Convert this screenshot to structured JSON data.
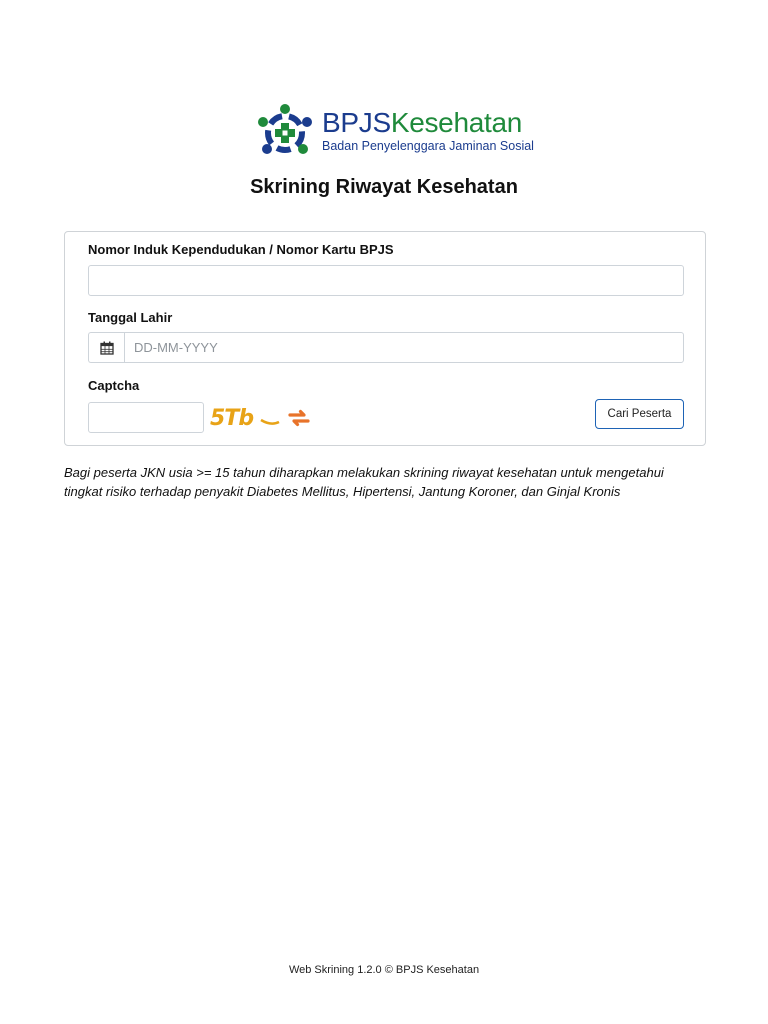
{
  "header": {
    "logo_brand_part1": "BPJS",
    "logo_brand_part2": "Kesehatan",
    "logo_subtitle": "Badan Penyelenggara Jaminan Sosial",
    "page_title": "Skrining Riwayat Kesehatan"
  },
  "form": {
    "nik_label": "Nomor Induk Kependudukan / Nomor Kartu BPJS",
    "nik_value": "",
    "dob_label": "Tanggal Lahir",
    "dob_placeholder": "DD-MM-YYYY",
    "dob_value": "",
    "captcha_label": "Captcha",
    "captcha_value": "",
    "captcha_image_text": "5Tb",
    "search_button_label": "Cari Peserta"
  },
  "icons": {
    "date_picker": "calendar-icon",
    "refresh": "refresh-icon"
  },
  "colors": {
    "brand_blue": "#1b3c8e",
    "brand_green": "#1f8a3b",
    "button_border": "#1e63b5",
    "captcha_text": "#e8a317",
    "refresh": "#e8732a"
  },
  "note": "Bagi peserta JKN usia >= 15 tahun diharapkan melakukan skrining riwayat kesehatan untuk mengetahui tingkat risiko terhadap penyakit Diabetes Mellitus, Hipertensi, Jantung Koroner, dan Ginjal Kronis",
  "footer": "Web Skrining 1.2.0 © BPJS Kesehatan"
}
